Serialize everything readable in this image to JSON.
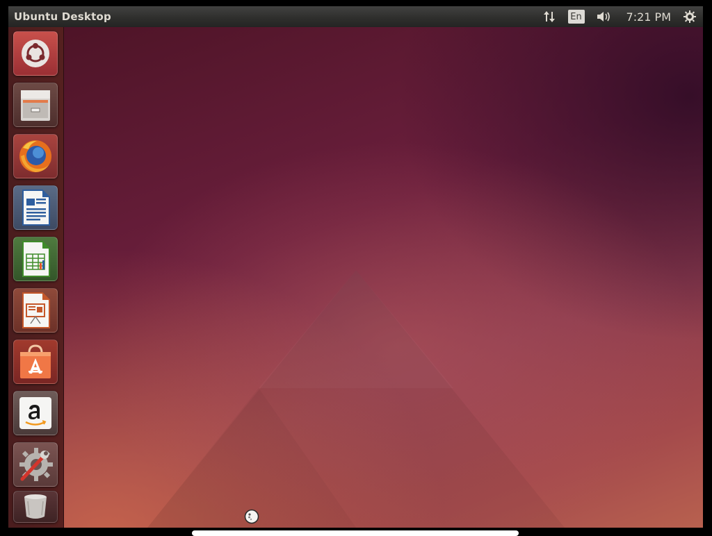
{
  "topbar": {
    "title": "Ubuntu Desktop",
    "language": "En",
    "clock": "7:21 PM",
    "icons": [
      "network-updown-icon",
      "keyboard-language-indicator",
      "sound-volume-icon",
      "session-gear-icon"
    ]
  },
  "launcher": {
    "items": [
      {
        "name": "ubuntu-dash",
        "icon": "ubuntu-logo-icon"
      },
      {
        "name": "files",
        "icon": "file-cabinet-icon"
      },
      {
        "name": "firefox",
        "icon": "firefox-icon"
      },
      {
        "name": "libreoffice-writer",
        "icon": "writer-document-icon"
      },
      {
        "name": "libreoffice-calc",
        "icon": "calc-spreadsheet-icon"
      },
      {
        "name": "libreoffice-impress",
        "icon": "impress-presentation-icon"
      },
      {
        "name": "ubuntu-software-center",
        "icon": "shopping-bag-icon"
      },
      {
        "name": "amazon",
        "icon": "amazon-icon"
      },
      {
        "name": "system-settings",
        "icon": "settings-wrench-gear-icon"
      },
      {
        "name": "trash",
        "icon": "trash-bin-icon"
      }
    ]
  },
  "colors": {
    "accent": "#dd4814",
    "panel": "#2f2f2d",
    "launcher_bg": "#4a1d1e"
  }
}
